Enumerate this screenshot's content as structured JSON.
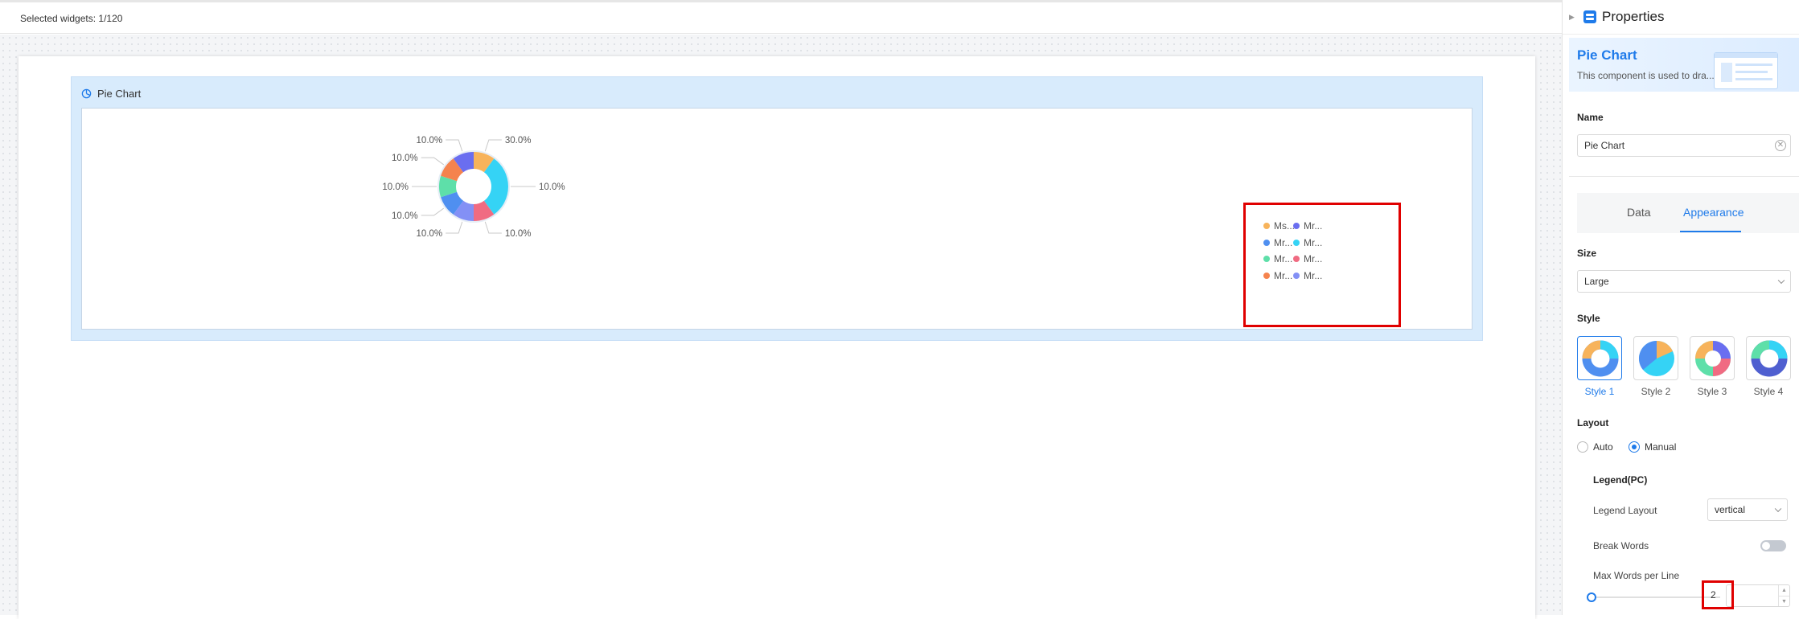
{
  "topbar": {
    "selected_text": "Selected widgets: 1/120"
  },
  "widget": {
    "title": "Pie Chart"
  },
  "chart_data": {
    "type": "pie",
    "donut": true,
    "slice_labels": [
      "30.0%",
      "10.0%",
      "10.0%",
      "10.0%",
      "10.0%",
      "10.0%",
      "10.0%",
      "10.0%"
    ],
    "series": [
      {
        "name": "Ms...",
        "value": 10,
        "color": "#f7b35b"
      },
      {
        "name": "Mr...",
        "value": 30,
        "color": "#35d3f5"
      },
      {
        "name": "Mr...",
        "value": 10,
        "color": "#f06b82"
      },
      {
        "name": "Mr...",
        "value": 10,
        "color": "#8390f5"
      },
      {
        "name": "Mr...",
        "value": 10,
        "color": "#4f8ff0"
      },
      {
        "name": "Mr...",
        "value": 10,
        "color": "#5edfa9"
      },
      {
        "name": "Mr...",
        "value": 10,
        "color": "#f5834d"
      },
      {
        "name": "Mr...",
        "value": 10,
        "color": "#6a6ef0"
      }
    ],
    "legend": {
      "position": "right",
      "items": [
        {
          "label": "Ms...",
          "color": "#f7b35b"
        },
        {
          "label": "Mr...",
          "color": "#6a6ef0"
        },
        {
          "label": "Mr...",
          "color": "#4f8ff0"
        },
        {
          "label": "Mr...",
          "color": "#35d3f5"
        },
        {
          "label": "Mr...",
          "color": "#5edfa9"
        },
        {
          "label": "Mr...",
          "color": "#f06b82"
        },
        {
          "label": "Mr...",
          "color": "#f5834d"
        },
        {
          "label": "Mr...",
          "color": "#8390f5"
        }
      ]
    }
  },
  "panel": {
    "title": "Properties",
    "banner_title": "Pie Chart",
    "banner_desc": "This component is used to dra...",
    "name_label": "Name",
    "name_value": "Pie Chart",
    "tab_data": "Data",
    "tab_appearance": "Appearance",
    "size_label": "Size",
    "size_value": "Large",
    "style_label": "Style",
    "styles": [
      "Style 1",
      "Style 2",
      "Style 3",
      "Style 4"
    ],
    "layout_label": "Layout",
    "layout_auto": "Auto",
    "layout_manual": "Manual",
    "legend_pc": "Legend(PC)",
    "legend_layout_label": "Legend Layout",
    "legend_layout_value": "vertical",
    "break_words_label": "Break Words",
    "max_words_label": "Max Words per Line",
    "max_words_value": "2"
  },
  "colors": {
    "accent": "#1f7bea",
    "highlight": "#e00000"
  }
}
